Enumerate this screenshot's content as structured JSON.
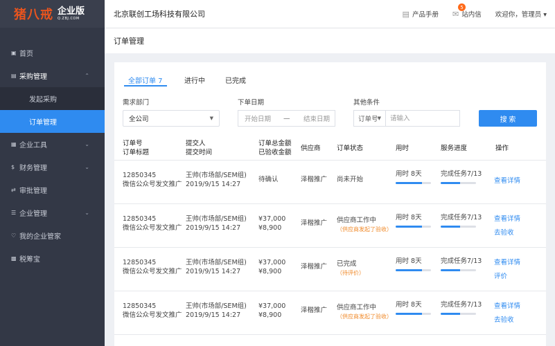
{
  "logo": {
    "mark": "猪八戒",
    "title": "企业版",
    "sub": "Q.ZBJ.COM"
  },
  "company": "北京联创工场科技有限公司",
  "topbar": {
    "manual": "产品手册",
    "messages": "站内信",
    "message_count": "5",
    "user": "欢迎你，管理员 ▾"
  },
  "sidebar": {
    "items": [
      {
        "icon": "home-icon",
        "label": "首页"
      },
      {
        "icon": "cart-icon",
        "label": "采购管理",
        "expanded": true
      },
      {
        "sub": true,
        "label": "发起采购"
      },
      {
        "sub": true,
        "label": "订单管理",
        "active": true
      },
      {
        "icon": "grid-icon",
        "label": "企业工具"
      },
      {
        "icon": "dollar-icon",
        "label": "财务管理"
      },
      {
        "icon": "shuffle-icon",
        "label": "审批管理"
      },
      {
        "icon": "list-icon",
        "label": "企业管理"
      },
      {
        "icon": "bell-icon",
        "label": "我的企业管家"
      },
      {
        "icon": "doc-icon",
        "label": "税筹宝"
      }
    ]
  },
  "page_title": "订单管理",
  "tabs": [
    {
      "label": "全部订单 7",
      "active": true
    },
    {
      "label": "进行中"
    },
    {
      "label": "已完成"
    }
  ],
  "filters": {
    "dept_label": "需求部门",
    "dept_value": "全公司",
    "date_label": "下单日期",
    "start_placeholder": "开始日期",
    "date_sep": "—",
    "end_placeholder": "结束日期",
    "other_label": "其他条件",
    "field_value": "订单号",
    "search_placeholder": "请输入",
    "search_button": "搜 索"
  },
  "table": {
    "headers": {
      "order_no": "订单号",
      "order_title": "订单标题",
      "submitter": "提交人",
      "submit_time": "提交时间",
      "total": "订单总金额",
      "accepted": "已验收金额",
      "supplier": "供应商",
      "status": "订单状态",
      "time_used": "用时",
      "progress": "服务进度",
      "action": "操作"
    },
    "rows": [
      {
        "order_no": "12850345",
        "title": "微信公众号发文推广",
        "submitter": "王帅(市场部/SEM组)",
        "time": "2019/9/15 14:27",
        "total": "待确认",
        "accepted": "",
        "supplier": "泽楷推广",
        "status": "尚未开始",
        "note": "",
        "used": "用时 8天",
        "used_pct": 0.75,
        "task": "完成任务7/13",
        "task_pct": 0.54,
        "action1": "查看详情",
        "action2": ""
      },
      {
        "order_no": "12850345",
        "title": "微信公众号发文推广",
        "submitter": "王帅(市场部/SEM组)",
        "time": "2019/9/15 14:27",
        "total": "¥37,000",
        "accepted": "¥8,900",
        "supplier": "泽楷推广",
        "status": "供应商工作中",
        "note": "（供应商发起了验收）",
        "used": "用时 8天",
        "used_pct": 0.75,
        "task": "完成任务7/13",
        "task_pct": 0.54,
        "action1": "查看详情",
        "action2": "去验收"
      },
      {
        "order_no": "12850345",
        "title": "微信公众号发文推广",
        "submitter": "王帅(市场部/SEM组)",
        "time": "2019/9/15 14:27",
        "total": "¥37,000",
        "accepted": "¥8,900",
        "supplier": "泽楷推广",
        "status": "已完成",
        "note": "（待评价）",
        "used": "用时 8天",
        "used_pct": 0.75,
        "task": "完成任务7/13",
        "task_pct": 0.54,
        "action1": "查看详情",
        "action2": "评价"
      },
      {
        "order_no": "12850345",
        "title": "微信公众号发文推广",
        "submitter": "王帅(市场部/SEM组)",
        "time": "2019/9/15 14:27",
        "total": "¥37,000",
        "accepted": "¥8,900",
        "supplier": "泽楷推广",
        "status": "供应商工作中",
        "note": "（供应商发起了验收）",
        "used": "用时 8天",
        "used_pct": 0.75,
        "task": "完成任务7/13",
        "task_pct": 0.54,
        "action1": "查看详情",
        "action2": "去验收"
      }
    ]
  },
  "colors": {
    "accent": "#2f8bf0",
    "sidebar": "#333846",
    "note": "#f08a2a",
    "logo": "#e8541e"
  }
}
